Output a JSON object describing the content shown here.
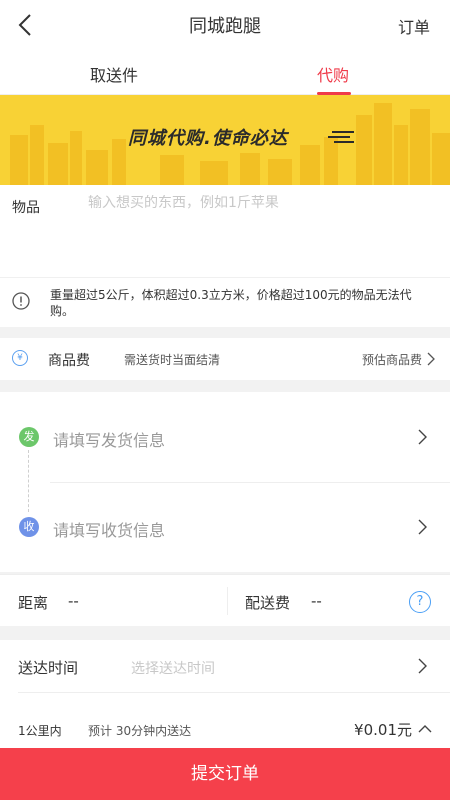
{
  "header": {
    "title": "同城跑腿",
    "right_link": "订单"
  },
  "tabs": [
    {
      "label": "取送件",
      "active": false
    },
    {
      "label": "代购",
      "active": true
    }
  ],
  "banner": {
    "text": "同城代购.使命必达"
  },
  "item": {
    "label": "物品",
    "placeholder": "输入想买的东西，例如1斤苹果"
  },
  "notice": {
    "text": "重量超过5公斤，体积超过0.3立方米，价格超过100元的物品无法代购。"
  },
  "goods_fee": {
    "label": "商品费",
    "hint": "需送货时当面结清",
    "estimate_link": "预估商品费",
    "icon_glyph": "¥"
  },
  "address": {
    "send_badge": "发",
    "send_placeholder": "请填写发货信息",
    "receive_badge": "收",
    "receive_placeholder": "请填写收货信息"
  },
  "distance": {
    "label": "距离",
    "value": "--",
    "fee_label": "配送费",
    "fee_value": "--",
    "help_glyph": "?"
  },
  "delivery_time": {
    "label": "送达时间",
    "placeholder": "选择送达时间"
  },
  "summary": {
    "range": "1公里内",
    "eta": "预计 30分钟内送达",
    "price": "¥0.01元"
  },
  "submit_label": "提交订单",
  "colors": {
    "accent": "#ef3b4a",
    "submit_bg": "#f5404b",
    "banner_bg": "#f8d235",
    "send_dot": "#6cc76a",
    "receive_dot": "#6f92e8",
    "help_blue": "#4a9ff5"
  }
}
